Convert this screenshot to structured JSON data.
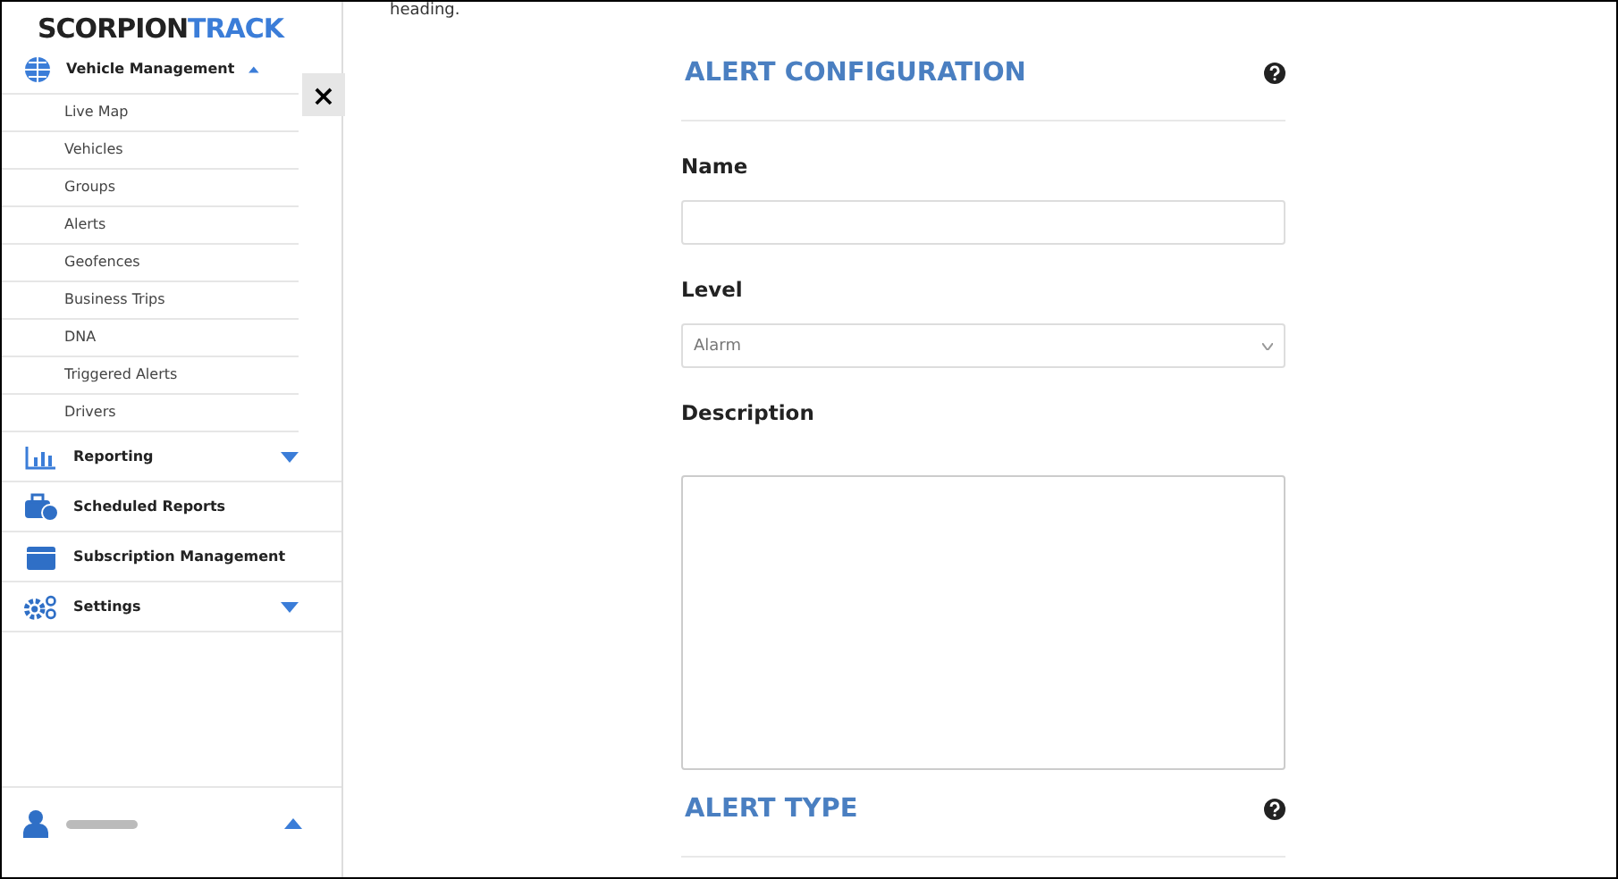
{
  "sidebar": {
    "logo": {
      "part_1": "SCORPION",
      "part_2": "TRACK"
    },
    "close_button": "×",
    "items": [
      {
        "label": "Vehicle Management",
        "kind": "group",
        "expanded": true,
        "children": [
          {
            "label": "Live Map"
          },
          {
            "label": "Vehicles"
          },
          {
            "label": "Groups"
          },
          {
            "label": "Alerts"
          },
          {
            "label": "Geofences"
          },
          {
            "label": "Business Trips"
          },
          {
            "label": "DNA"
          },
          {
            "label": "Triggered Alerts"
          },
          {
            "label": "Drivers"
          }
        ]
      },
      {
        "label": "Reporting",
        "kind": "group",
        "expanded": false
      },
      {
        "label": "Scheduled Reports",
        "kind": "link"
      },
      {
        "label": "Subscription Management",
        "kind": "link"
      },
      {
        "label": "Settings",
        "kind": "group",
        "expanded": false
      }
    ],
    "user": {
      "expanded": true
    }
  },
  "main": {
    "top_text": "heading.",
    "sections": [
      {
        "title": "ALERT CONFIGURATION",
        "fields": [
          {
            "kind": "text",
            "label": "Name"
          },
          {
            "kind": "select",
            "label": "Level",
            "value": "Alarm"
          },
          {
            "kind": "textarea",
            "label": "Description"
          }
        ]
      },
      {
        "title": "ALERT TYPE"
      }
    ]
  }
}
